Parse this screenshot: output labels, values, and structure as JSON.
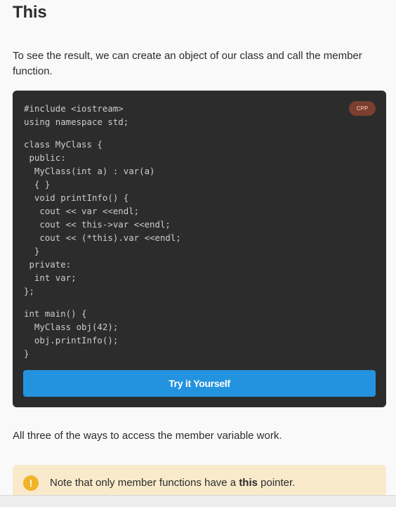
{
  "header": {
    "title": "This"
  },
  "intro_text": "To see the result, we can create an object of our class and call the member function.",
  "code_block": {
    "language_badge": "CPP",
    "lines": [
      "#include <iostream>",
      "using namespace std;",
      "",
      "class MyClass {",
      " public:",
      "  MyClass(int a) : var(a)",
      "  { }",
      "  void printInfo() {",
      "   cout << var <<endl;",
      "   cout << this->var <<endl;",
      "   cout << (*this).var <<endl;",
      "  }",
      " private:",
      "  int var;",
      "};",
      "",
      "int main() {",
      "  MyClass obj(42);",
      "  obj.printInfo();",
      "}"
    ],
    "try_button_label": "Try it Yourself"
  },
  "outro_text": "All three of the ways to access the member variable work.",
  "note": {
    "icon": "exclamation-icon",
    "text_before": "Note that only member functions have a ",
    "text_bold": "this",
    "text_after": " pointer."
  }
}
